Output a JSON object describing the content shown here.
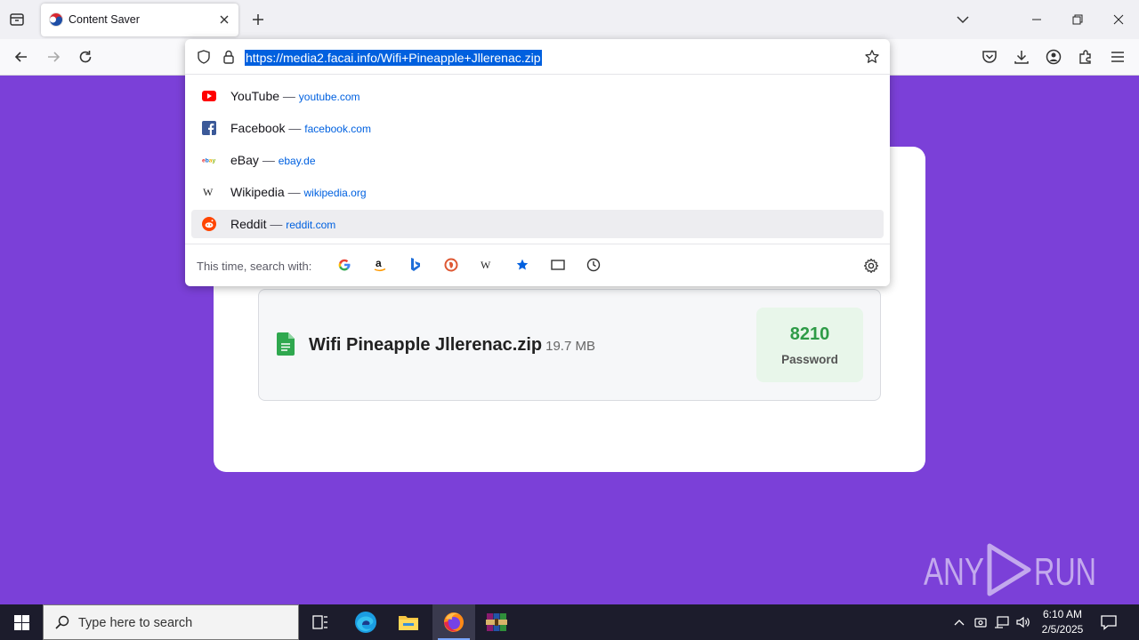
{
  "browser": {
    "tab": {
      "title": "Content Saver",
      "favicon": "content-saver-favicon"
    },
    "url": "https://media2.facai.info/Wifi+Pineapple+Jllerenac.zip",
    "suggestions": [
      {
        "title": "YouTube",
        "separator": "—",
        "url": "youtube.com",
        "icon": "youtube-icon"
      },
      {
        "title": "Facebook",
        "separator": "—",
        "url": "facebook.com",
        "icon": "facebook-icon"
      },
      {
        "title": "eBay",
        "separator": "—",
        "url": "ebay.de",
        "icon": "ebay-icon"
      },
      {
        "title": "Wikipedia",
        "separator": "—",
        "url": "wikipedia.org",
        "icon": "wikipedia-icon"
      },
      {
        "title": "Reddit",
        "separator": "—",
        "url": "reddit.com",
        "icon": "reddit-icon"
      }
    ],
    "search_label": "This time, search with:",
    "search_engines": [
      "google-icon",
      "amazon-icon",
      "bing-icon",
      "duckduckgo-icon",
      "wikipedia-icon",
      "bookmarks-icon",
      "tabs-icon",
      "history-icon"
    ]
  },
  "page": {
    "file_name": "Wifi Pineapple Jllerenac.zip",
    "file_size": "19.7 MB",
    "password_code": "8210",
    "password_label": "Password"
  },
  "watermark": "ANY RUN",
  "taskbar": {
    "search_placeholder": "Type here to search",
    "time": "6:10 AM",
    "date": "2/5/2025"
  },
  "colors": {
    "page_background": "#7b40d8",
    "url_selection": "#0061e0",
    "password_green": "#2e9b47"
  }
}
